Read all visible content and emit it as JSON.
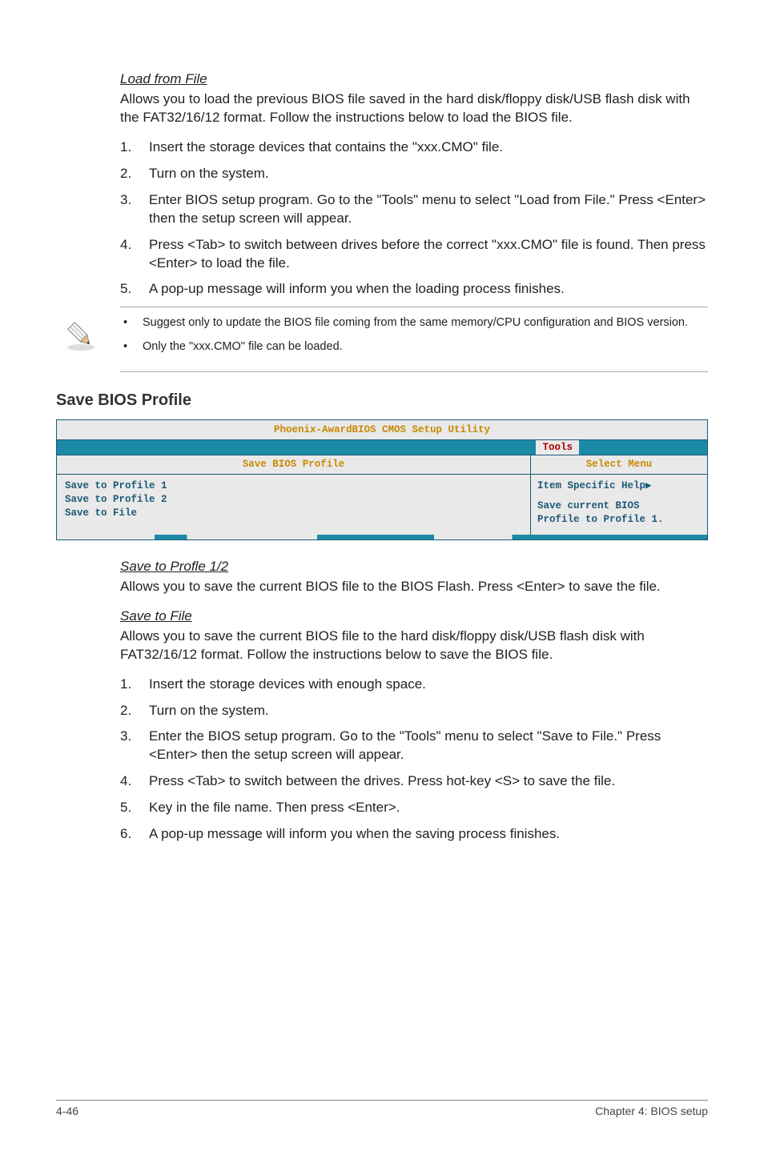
{
  "section1": {
    "heading": "Load from File",
    "intro": "Allows you to load the previous BIOS file saved in the hard disk/floppy disk/USB flash disk with the FAT32/16/12 format. Follow the instructions below to load the BIOS file.",
    "steps": [
      "Insert the storage devices that contains the \"xxx.CMO\" file.",
      "Turn on the system.",
      "Enter BIOS setup program. Go to the \"Tools\" menu to select \"Load from File.\" Press <Enter> then the setup screen will appear.",
      "Press <Tab> to switch between drives before the correct \"xxx.CMO\" file is found. Then press <Enter> to load the file.",
      "A pop-up message will inform you when the loading process finishes."
    ],
    "notes": [
      "Suggest only to update the BIOS file coming from the same memory/CPU configuration and BIOS version.",
      "Only the \"xxx.CMO\" file can be loaded."
    ]
  },
  "section2_title": "Save BIOS Profile",
  "bios": {
    "title": "Phoenix-AwardBIOS CMOS Setup Utility",
    "tab": "Tools",
    "left_header": "Save BIOS Profile",
    "right_header": "Select Menu",
    "left_items": "Save to Profile 1\nSave to Profile 2\nSave to File",
    "right_help_title": "Item Specific Help",
    "right_help_body1": "Save current BIOS",
    "right_help_body2": "Profile to Profile 1."
  },
  "section3": {
    "heading": "Save to Profle 1/2",
    "text": "Allows you to save the current BIOS file to the BIOS Flash. Press <Enter> to save the file."
  },
  "section4": {
    "heading": "Save to File",
    "text": "Allows you to save the current BIOS file to the hard disk/floppy disk/USB flash disk with FAT32/16/12 format. Follow the instructions below to save the BIOS file.",
    "steps": [
      "Insert the storage devices with enough space.",
      "Turn on the system.",
      "Enter the BIOS setup program. Go to the \"Tools\" menu to select \"Save to File.\" Press <Enter> then the setup screen will appear.",
      "Press <Tab> to switch between the drives. Press hot-key <S> to save the file.",
      "Key in the file name. Then press <Enter>.",
      "A pop-up message will inform you when the saving process finishes."
    ]
  },
  "footer": {
    "left": "4-46",
    "right": "Chapter 4: BIOS setup"
  }
}
